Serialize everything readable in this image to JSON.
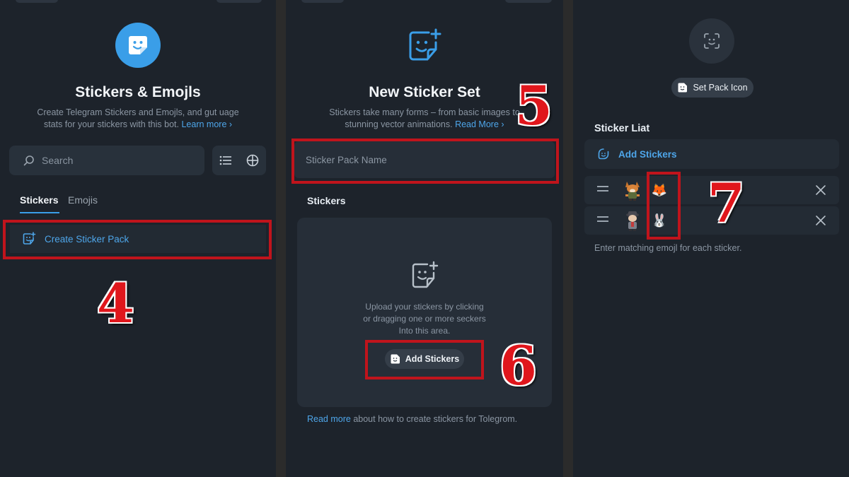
{
  "colors": {
    "accent": "#3a9ee8",
    "panel_bg": "#1d232b",
    "annotation_red": "#c0141c"
  },
  "panel1": {
    "title": "Stickers & Emojls",
    "description": "Create Telegram Stickers and Emojls, and gut uage stats for your stickers with this bot.",
    "learn_more": "Learn more",
    "search_placeholder": "Search",
    "tabs": [
      {
        "label": "Stickers",
        "active": true
      },
      {
        "label": "Emojis",
        "active": false
      }
    ],
    "create_pack_label": "Create Sticker Pack",
    "step_number": "4",
    "icons": {
      "app": "sticker-smile-icon",
      "search": "search-icon",
      "list": "list-view-icon",
      "grid": "grid-view-icon",
      "create": "sticker-add-icon"
    }
  },
  "panel2": {
    "title": "New Sticker Set",
    "description": "Stickers take many forms – from basic images to stunning vector animations.",
    "read_more": "Read More",
    "name_placeholder": "Sticker Pack Name",
    "stickers_label": "Stickers",
    "upload_text": "Upload your stickers by clicking or dragging one or more seckers Into this area.",
    "add_stickers_label": "Add Stickers",
    "footer_link": "Read more",
    "footer_text": "about how to create stickers for Tolegrom.",
    "step_numbers": [
      "5",
      "6"
    ],
    "icons": {
      "header": "sticker-add-icon",
      "upload": "sticker-add-icon",
      "add": "sticker-add-icon"
    }
  },
  "panel3": {
    "set_pack_icon_label": "Set Pack Icon",
    "list_label": "Sticker Liat",
    "add_stickers_label": "Add Stickers",
    "rows": [
      {
        "thumb": "fox-character-sticker",
        "emoji": "🦊"
      },
      {
        "thumb": "detective-character-sticker",
        "emoji": "🐰"
      }
    ],
    "hint": "Enter matching emojl for each sticker.",
    "step_number": "7",
    "icons": {
      "avatar": "sticker-placeholder-icon",
      "pack": "sticker-icon",
      "add": "sticker-add-icon",
      "drag": "drag-handle-icon",
      "remove": "close-icon"
    }
  }
}
